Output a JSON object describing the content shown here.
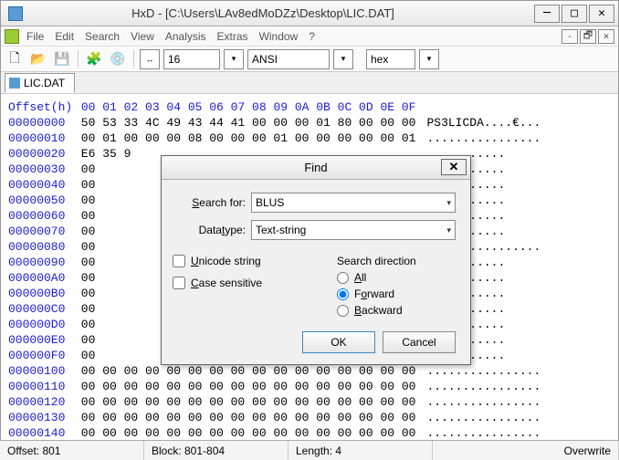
{
  "title": "HxD - [C:\\Users\\LAv8edMoDZz\\Desktop\\LIC.DAT]",
  "menu": {
    "file": "File",
    "edit": "Edit",
    "search": "Search",
    "view": "View",
    "analysis": "Analysis",
    "extras": "Extras",
    "window": "Window",
    "help": "?"
  },
  "toolbar": {
    "bytes": "16",
    "charset": "ANSI",
    "base": "hex"
  },
  "tab": {
    "label": "LIC.DAT"
  },
  "hex": {
    "header_label": "Offset(h)",
    "cols": "00 01 02 03 04 05 06 07 08 09 0A 0B 0C 0D 0E 0F",
    "rows": [
      {
        "off": "00000000",
        "b": "50 53 33 4C 49 43 44 41 00 00 00 01 80 00 00 00",
        "a": "PS3LICDA....€..."
      },
      {
        "off": "00000010",
        "b": "00 01 00 00 00 08 00 00 00 01 00 00 00 00 00 01",
        "a": "................"
      },
      {
        "off": "00000020",
        "b": "E6 35 9",
        "a": "..........."
      },
      {
        "off": "00000030",
        "b": "00",
        "a": "..........."
      },
      {
        "off": "00000040",
        "b": "00",
        "a": "..........."
      },
      {
        "off": "00000050",
        "b": "00",
        "a": "..........."
      },
      {
        "off": "00000060",
        "b": "00",
        "a": "..........."
      },
      {
        "off": "00000070",
        "b": "00",
        "a": "..........."
      },
      {
        "off": "00000080",
        "b": "00",
        "a": "................"
      },
      {
        "off": "00000090",
        "b": "00",
        "a": "..........."
      },
      {
        "off": "000000A0",
        "b": "00",
        "a": "..........."
      },
      {
        "off": "000000B0",
        "b": "00",
        "a": "..........."
      },
      {
        "off": "000000C0",
        "b": "00",
        "a": "..........."
      },
      {
        "off": "000000D0",
        "b": "00",
        "a": "..........."
      },
      {
        "off": "000000E0",
        "b": "00",
        "a": "..........."
      },
      {
        "off": "000000F0",
        "b": "00",
        "a": "..........."
      },
      {
        "off": "00000100",
        "b": "00 00 00 00 00 00 00 00 00 00 00 00 00 00 00 00",
        "a": "................"
      },
      {
        "off": "00000110",
        "b": "00 00 00 00 00 00 00 00 00 00 00 00 00 00 00 00",
        "a": "................"
      },
      {
        "off": "00000120",
        "b": "00 00 00 00 00 00 00 00 00 00 00 00 00 00 00 00",
        "a": "................"
      },
      {
        "off": "00000130",
        "b": "00 00 00 00 00 00 00 00 00 00 00 00 00 00 00 00",
        "a": "................"
      },
      {
        "off": "00000140",
        "b": "00 00 00 00 00 00 00 00 00 00 00 00 00 00 00 00",
        "a": "................"
      }
    ]
  },
  "dialog": {
    "title": "Find",
    "search_for_label": "Search for:",
    "search_for_value": "BLUS",
    "datatype_label": "Datatype:",
    "datatype_value": "Text-string",
    "unicode": "Unicode string",
    "case": "Case sensitive",
    "direction_label": "Search direction",
    "dir_all": "All",
    "dir_forward": "Forward",
    "dir_backward": "Backward",
    "ok": "OK",
    "cancel": "Cancel"
  },
  "status": {
    "offset": "Offset: 801",
    "block": "Block: 801-804",
    "length": "Length: 4",
    "mode": "Overwrite"
  }
}
